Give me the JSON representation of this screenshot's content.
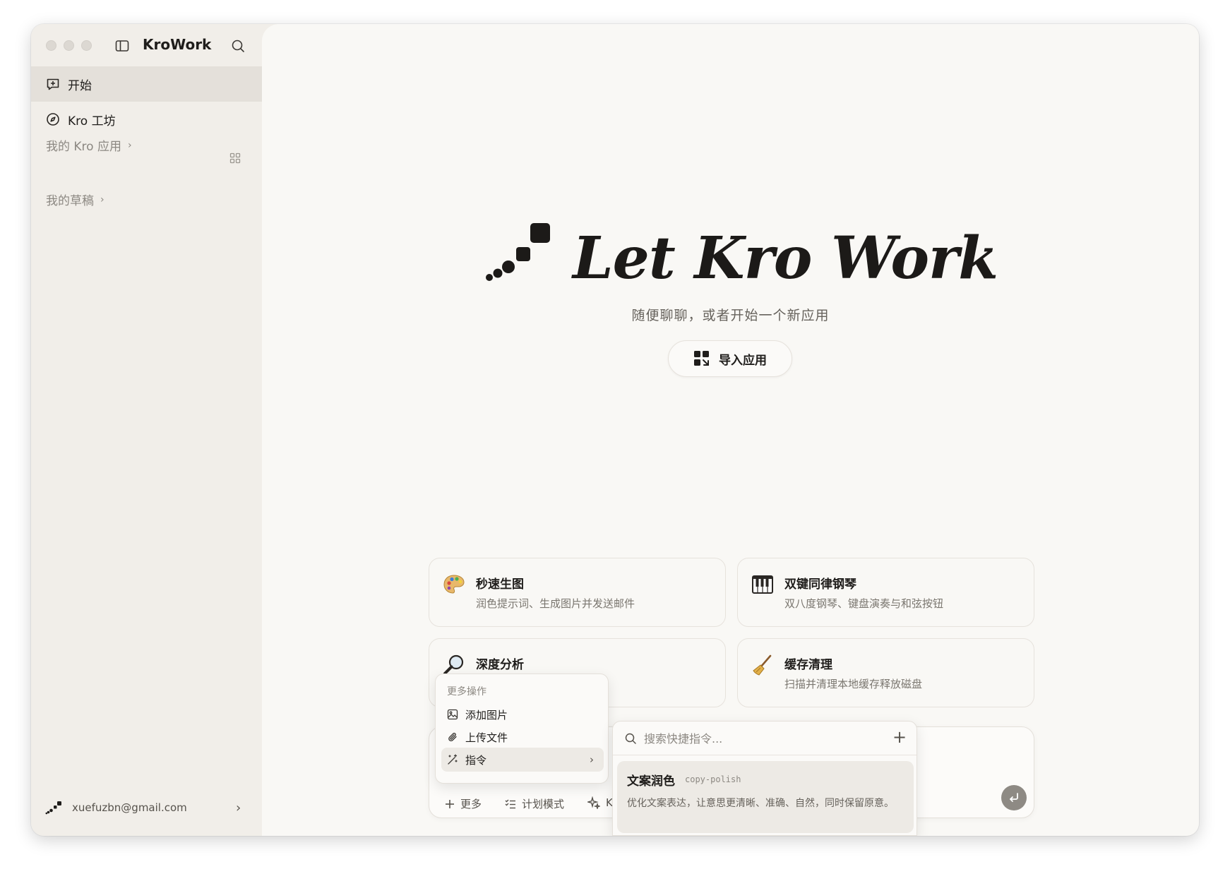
{
  "app": {
    "title": "KroWork"
  },
  "sidebar": {
    "nav": [
      {
        "label": "开始",
        "icon": "new-chat-icon",
        "active": true
      },
      {
        "label": "Kro 工坊",
        "icon": "compass-icon",
        "active": false
      }
    ],
    "sections": [
      {
        "label": "我的 Kro 应用",
        "chevron": "›"
      },
      {
        "label": "我的草稿",
        "chevron": "›"
      }
    ],
    "account": {
      "email": "xuefuzbn@gmail.com",
      "chevron": "›"
    }
  },
  "hero": {
    "title": "Let Kro Work",
    "subtitle": "随便聊聊，或者开始一个新应用",
    "import_label": "导入应用"
  },
  "cards": [
    {
      "icon": "palette-icon",
      "title": "秒速生图",
      "desc": "润色提示词、生成图片并发送邮件"
    },
    {
      "icon": "piano-icon",
      "title": "双键同律钢琴",
      "desc": "双八度钢琴、键盘演奏与和弦按钮"
    },
    {
      "icon": "magnifier-icon",
      "title": "深度分析",
      "desc": ""
    },
    {
      "icon": "broom-icon",
      "title": "缓存清理",
      "desc": "扫描并清理本地缓存释放磁盘"
    }
  ],
  "composer": {
    "more_label": "更多",
    "plan_label": "计划模式",
    "kro_label": "K"
  },
  "more_menu": {
    "header": "更多操作",
    "items": [
      {
        "label": "添加图片",
        "icon": "image-icon"
      },
      {
        "label": "上传文件",
        "icon": "paperclip-icon"
      },
      {
        "label": "指令",
        "icon": "wand-icon",
        "chevron": "›"
      }
    ]
  },
  "command_popup": {
    "placeholder": "搜索快捷指令...",
    "add_symbol": "+",
    "items": [
      {
        "name": "文案润色",
        "slug": "copy-polish",
        "desc": "优化文案表达，让意思更清晰、准确、自然，同时保留原意。"
      }
    ]
  }
}
